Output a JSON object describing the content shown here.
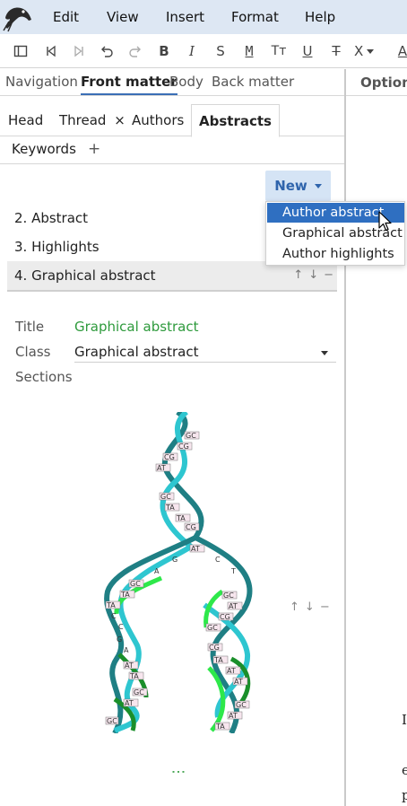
{
  "menubar": {
    "items": [
      "Edit",
      "View",
      "Insert",
      "Format",
      "Help"
    ]
  },
  "toolbar": {
    "icons": [
      "sidebar-icon",
      "skip-back-icon",
      "skip-forward-icon",
      "undo-icon",
      "redo-icon",
      "bold-icon",
      "italic-icon",
      "smallcaps-icon",
      "monospace-icon",
      "text-size-icon",
      "underline-icon",
      "strikethrough-icon",
      "clear-format-icon"
    ],
    "glyphs": {
      "bold": "B",
      "italic": "I",
      "smallcaps": "S",
      "monospace": "M",
      "textsize": "Tт",
      "underline": "U",
      "strike": "T",
      "clear": "X"
    }
  },
  "top_tabs": {
    "navigation": "Navigation",
    "front_matter": "Front matter",
    "body": "Body",
    "back_matter": "Back matter"
  },
  "sub_tabs": {
    "head": "Head",
    "thread": "Thread",
    "thread_close": "×",
    "authors": "Authors",
    "abstracts": "Abstracts",
    "keywords": "Keywords",
    "add": "+"
  },
  "new_button": {
    "label": "New"
  },
  "abstract_list": [
    {
      "label": "2. Abstract"
    },
    {
      "label": "3. Highlights"
    },
    {
      "label": "4. Graphical abstract"
    }
  ],
  "row_controls": {
    "up": "↑",
    "down": "↓",
    "remove": "−"
  },
  "fields": {
    "title_label": "Title",
    "title_value": "Graphical abstract",
    "class_label": "Class",
    "class_value": "Graphical abstract",
    "sections_label": "Sections"
  },
  "dropdown": {
    "items": [
      "Author abstract",
      "Graphical abstract",
      "Author highlights"
    ],
    "hovered_index": 0
  },
  "right_pane": {
    "options_label": "Options",
    "edge_chars": [
      "I",
      "e",
      "p"
    ]
  },
  "colors": {
    "accent": "#2f6fc1",
    "green": "#2e9a3c",
    "menubar_bg": "#dde7f3"
  }
}
